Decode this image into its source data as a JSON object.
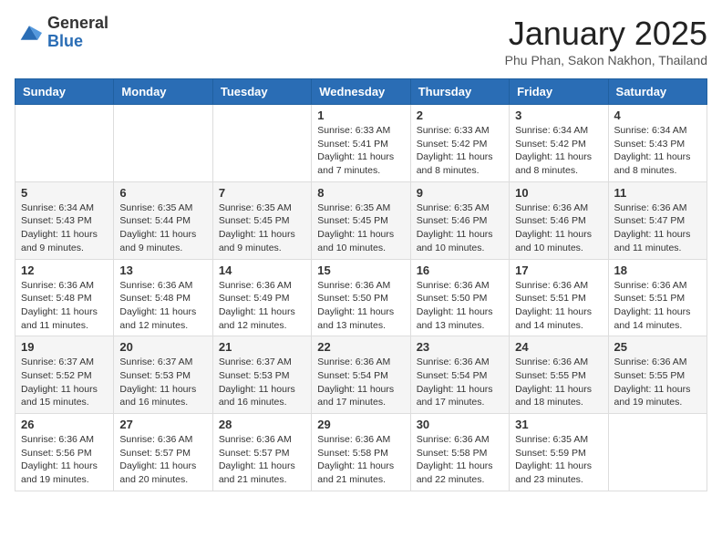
{
  "header": {
    "logo_general": "General",
    "logo_blue": "Blue",
    "title": "January 2025",
    "location": "Phu Phan, Sakon Nakhon, Thailand"
  },
  "weekdays": [
    "Sunday",
    "Monday",
    "Tuesday",
    "Wednesday",
    "Thursday",
    "Friday",
    "Saturday"
  ],
  "weeks": [
    [
      {
        "day": "",
        "info": ""
      },
      {
        "day": "",
        "info": ""
      },
      {
        "day": "",
        "info": ""
      },
      {
        "day": "1",
        "info": "Sunrise: 6:33 AM\nSunset: 5:41 PM\nDaylight: 11 hours and 7 minutes."
      },
      {
        "day": "2",
        "info": "Sunrise: 6:33 AM\nSunset: 5:42 PM\nDaylight: 11 hours and 8 minutes."
      },
      {
        "day": "3",
        "info": "Sunrise: 6:34 AM\nSunset: 5:42 PM\nDaylight: 11 hours and 8 minutes."
      },
      {
        "day": "4",
        "info": "Sunrise: 6:34 AM\nSunset: 5:43 PM\nDaylight: 11 hours and 8 minutes."
      }
    ],
    [
      {
        "day": "5",
        "info": "Sunrise: 6:34 AM\nSunset: 5:43 PM\nDaylight: 11 hours and 9 minutes."
      },
      {
        "day": "6",
        "info": "Sunrise: 6:35 AM\nSunset: 5:44 PM\nDaylight: 11 hours and 9 minutes."
      },
      {
        "day": "7",
        "info": "Sunrise: 6:35 AM\nSunset: 5:45 PM\nDaylight: 11 hours and 9 minutes."
      },
      {
        "day": "8",
        "info": "Sunrise: 6:35 AM\nSunset: 5:45 PM\nDaylight: 11 hours and 10 minutes."
      },
      {
        "day": "9",
        "info": "Sunrise: 6:35 AM\nSunset: 5:46 PM\nDaylight: 11 hours and 10 minutes."
      },
      {
        "day": "10",
        "info": "Sunrise: 6:36 AM\nSunset: 5:46 PM\nDaylight: 11 hours and 10 minutes."
      },
      {
        "day": "11",
        "info": "Sunrise: 6:36 AM\nSunset: 5:47 PM\nDaylight: 11 hours and 11 minutes."
      }
    ],
    [
      {
        "day": "12",
        "info": "Sunrise: 6:36 AM\nSunset: 5:48 PM\nDaylight: 11 hours and 11 minutes."
      },
      {
        "day": "13",
        "info": "Sunrise: 6:36 AM\nSunset: 5:48 PM\nDaylight: 11 hours and 12 minutes."
      },
      {
        "day": "14",
        "info": "Sunrise: 6:36 AM\nSunset: 5:49 PM\nDaylight: 11 hours and 12 minutes."
      },
      {
        "day": "15",
        "info": "Sunrise: 6:36 AM\nSunset: 5:50 PM\nDaylight: 11 hours and 13 minutes."
      },
      {
        "day": "16",
        "info": "Sunrise: 6:36 AM\nSunset: 5:50 PM\nDaylight: 11 hours and 13 minutes."
      },
      {
        "day": "17",
        "info": "Sunrise: 6:36 AM\nSunset: 5:51 PM\nDaylight: 11 hours and 14 minutes."
      },
      {
        "day": "18",
        "info": "Sunrise: 6:36 AM\nSunset: 5:51 PM\nDaylight: 11 hours and 14 minutes."
      }
    ],
    [
      {
        "day": "19",
        "info": "Sunrise: 6:37 AM\nSunset: 5:52 PM\nDaylight: 11 hours and 15 minutes."
      },
      {
        "day": "20",
        "info": "Sunrise: 6:37 AM\nSunset: 5:53 PM\nDaylight: 11 hours and 16 minutes."
      },
      {
        "day": "21",
        "info": "Sunrise: 6:37 AM\nSunset: 5:53 PM\nDaylight: 11 hours and 16 minutes."
      },
      {
        "day": "22",
        "info": "Sunrise: 6:36 AM\nSunset: 5:54 PM\nDaylight: 11 hours and 17 minutes."
      },
      {
        "day": "23",
        "info": "Sunrise: 6:36 AM\nSunset: 5:54 PM\nDaylight: 11 hours and 17 minutes."
      },
      {
        "day": "24",
        "info": "Sunrise: 6:36 AM\nSunset: 5:55 PM\nDaylight: 11 hours and 18 minutes."
      },
      {
        "day": "25",
        "info": "Sunrise: 6:36 AM\nSunset: 5:55 PM\nDaylight: 11 hours and 19 minutes."
      }
    ],
    [
      {
        "day": "26",
        "info": "Sunrise: 6:36 AM\nSunset: 5:56 PM\nDaylight: 11 hours and 19 minutes."
      },
      {
        "day": "27",
        "info": "Sunrise: 6:36 AM\nSunset: 5:57 PM\nDaylight: 11 hours and 20 minutes."
      },
      {
        "day": "28",
        "info": "Sunrise: 6:36 AM\nSunset: 5:57 PM\nDaylight: 11 hours and 21 minutes."
      },
      {
        "day": "29",
        "info": "Sunrise: 6:36 AM\nSunset: 5:58 PM\nDaylight: 11 hours and 21 minutes."
      },
      {
        "day": "30",
        "info": "Sunrise: 6:36 AM\nSunset: 5:58 PM\nDaylight: 11 hours and 22 minutes."
      },
      {
        "day": "31",
        "info": "Sunrise: 6:35 AM\nSunset: 5:59 PM\nDaylight: 11 hours and 23 minutes."
      },
      {
        "day": "",
        "info": ""
      }
    ]
  ]
}
